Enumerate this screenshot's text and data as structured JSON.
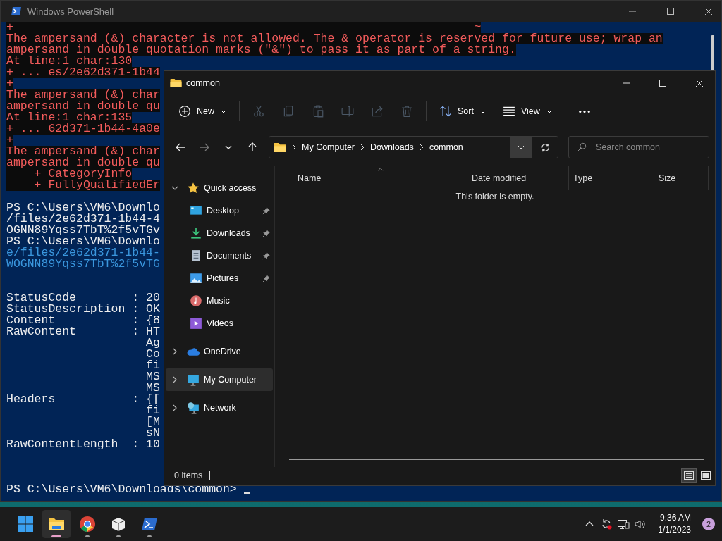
{
  "powershell": {
    "title": "Windows PowerShell",
    "blocks": [
      {
        "kind": "error",
        "lines": [
          {
            "kind": "error",
            "text": "+                                                                  ~"
          },
          {
            "kind": "error",
            "text": "The ampersand (&) character is not allowed. The & operator is reserved for future use; wrap an"
          },
          {
            "kind": "error",
            "text": "ampersand in double quotation marks (\"&\") to pass it as part of a string."
          },
          {
            "kind": "error",
            "text": "At line:1 char:130"
          },
          {
            "kind": "error",
            "text": "+ ... es/2e62d371-1b44"
          },
          {
            "kind": "error",
            "text": "+"
          },
          {
            "kind": "error",
            "text": "The ampersand (&) char"
          },
          {
            "kind": "error",
            "text": "ampersand in double qu"
          },
          {
            "kind": "error",
            "text": "At line:1 char:135"
          },
          {
            "kind": "error",
            "text": "+ ... 62d371-1b44-4a0e"
          },
          {
            "kind": "error",
            "text": "+"
          },
          {
            "kind": "error",
            "text": "The ampersand (&) char"
          },
          {
            "kind": "error",
            "text": "ampersand in double qu"
          },
          {
            "kind": "error",
            "text": "    + CategoryInfo"
          },
          {
            "kind": "error",
            "text": "    + FullyQualifiedEr"
          }
        ]
      },
      {
        "kind": "command",
        "lines": [
          {
            "kind": "output",
            "text": "PS C:\\Users\\VM6\\Downlo"
          },
          {
            "kind": "output",
            "text": "/files/2e62d371-1b44-4"
          },
          {
            "kind": "output",
            "text": "OGNN89Yqss7TbT%2f5vTGv"
          },
          {
            "kind": "output",
            "text": "PS C:\\Users\\VM6\\Downlo"
          },
          {
            "kind": "echo",
            "text": "e/files/2e62d371-1b44-"
          },
          {
            "kind": "echo",
            "text": "WOGNN89Yqss7TbT%2f5vTG"
          }
        ]
      },
      {
        "kind": "response",
        "lines": [
          {
            "kind": "output",
            "text": "StatusCode        : 20"
          },
          {
            "kind": "output",
            "text": "StatusDescription : OK"
          },
          {
            "kind": "output",
            "text": "Content           : {8"
          },
          {
            "kind": "output",
            "text": "RawContent        : HT"
          },
          {
            "kind": "output",
            "text": "                    Ag"
          },
          {
            "kind": "output",
            "text": "                    Co"
          },
          {
            "kind": "output",
            "text": "                    fi"
          },
          {
            "kind": "output",
            "text": "                    MS"
          },
          {
            "kind": "output",
            "text": "                    MS"
          },
          {
            "kind": "output",
            "text": "Headers           : {["
          },
          {
            "kind": "output",
            "text": "                    fi"
          },
          {
            "kind": "output",
            "text": "                    [M"
          },
          {
            "kind": "output",
            "text": "                    sN"
          },
          {
            "kind": "output",
            "text": "RawContentLength  : 10"
          }
        ]
      },
      {
        "kind": "prompt",
        "lines": [
          {
            "kind": "output",
            "text": "PS C:\\Users\\VM6\\Downloads\\common> "
          }
        ]
      }
    ]
  },
  "explorer": {
    "title": "common",
    "toolbar": [
      {
        "kind": "new",
        "label": "New",
        "disabled": false,
        "divider_after": true
      },
      {
        "kind": "cut",
        "disabled": true,
        "divider_after": false
      },
      {
        "kind": "copy",
        "disabled": true,
        "divider_after": false
      },
      {
        "kind": "paste",
        "disabled": true,
        "divider_after": false
      },
      {
        "kind": "rename",
        "disabled": true,
        "divider_after": false
      },
      {
        "kind": "share",
        "disabled": true,
        "divider_after": false
      },
      {
        "kind": "delete",
        "disabled": true,
        "divider_after": true
      },
      {
        "kind": "sort",
        "label": "Sort",
        "disabled": false,
        "divider_after": false
      },
      {
        "kind": "view",
        "label": "View",
        "disabled": false,
        "divider_after": true
      },
      {
        "kind": "more",
        "disabled": false,
        "divider_after": false
      }
    ],
    "nav_buttons": [
      {
        "kind": "back",
        "disabled": false
      },
      {
        "kind": "forward",
        "disabled": true
      },
      {
        "kind": "recent",
        "disabled": false
      },
      {
        "kind": "up",
        "disabled": false
      }
    ],
    "breadcrumbs": [
      "My Computer",
      "Downloads",
      "common"
    ],
    "search": {
      "placeholder": "Search common"
    },
    "nav_pane": [
      {
        "label": "Quick access",
        "kind": "star",
        "expanded": true,
        "selected": false,
        "children": [
          {
            "label": "Desktop",
            "kind": "desktop",
            "pinned": true,
            "selected": false
          },
          {
            "label": "Downloads",
            "kind": "downloads",
            "pinned": true,
            "selected": false
          },
          {
            "label": "Documents",
            "kind": "documents",
            "pinned": true,
            "selected": false
          },
          {
            "label": "Pictures",
            "kind": "pictures",
            "pinned": true,
            "selected": false
          },
          {
            "label": "Music",
            "kind": "music",
            "pinned": false,
            "selected": false
          },
          {
            "label": "Videos",
            "kind": "videos",
            "pinned": false,
            "selected": false
          }
        ]
      },
      {
        "label": "OneDrive",
        "kind": "cloud",
        "expanded": false,
        "selected": false
      },
      {
        "label": "My Computer",
        "kind": "computer",
        "expanded": false,
        "selected": true
      },
      {
        "label": "Network",
        "kind": "network",
        "expanded": false,
        "selected": false
      }
    ],
    "columns": [
      "Name",
      "Date modified",
      "Type",
      "Size"
    ],
    "empty_message": "This folder is empty.",
    "status": "0 items",
    "view_buttons": [
      {
        "kind": "details",
        "selected": true
      },
      {
        "kind": "tiles",
        "selected": false
      }
    ]
  },
  "taskbar": {
    "apps": [
      {
        "kind": "start",
        "active": false,
        "running": false
      },
      {
        "kind": "explorer",
        "active": true,
        "running": true
      },
      {
        "kind": "chrome",
        "active": false,
        "running": true
      },
      {
        "kind": "package",
        "active": false,
        "running": true
      },
      {
        "kind": "powershell",
        "active": false,
        "running": true
      }
    ],
    "tray": [
      {
        "kind": "caret"
      },
      {
        "kind": "sync"
      },
      {
        "kind": "network"
      },
      {
        "kind": "volume"
      }
    ],
    "time": "9:36 AM",
    "date": "1/1/2023",
    "notifications": "2"
  }
}
